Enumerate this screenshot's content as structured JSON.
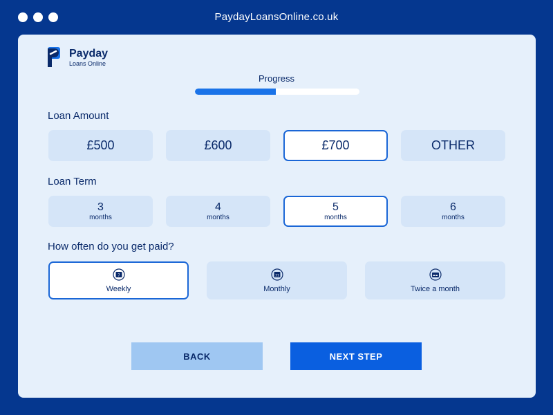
{
  "browser": {
    "url": "PaydayLoansOnline.co.uk"
  },
  "brand": {
    "name": "Payday",
    "tagline": "Loans Online",
    "accent": "#1a73e8"
  },
  "progress": {
    "label": "Progress",
    "fraction": 0.49
  },
  "loan_amount": {
    "label": "Loan Amount",
    "options": [
      "£500",
      "£600",
      "£700",
      "OTHER"
    ],
    "selected": "£700"
  },
  "loan_term": {
    "label": "Loan Term",
    "options": [
      {
        "value": "3",
        "unit": "months"
      },
      {
        "value": "4",
        "unit": "months"
      },
      {
        "value": "5",
        "unit": "months"
      },
      {
        "value": "6",
        "unit": "months"
      }
    ],
    "selected": "5"
  },
  "pay_frequency": {
    "label": "How often do you get paid?",
    "options": [
      {
        "label": "Weekly",
        "icon": "calendar-week-icon",
        "badge": "7"
      },
      {
        "label": "Monthly",
        "icon": "calendar-month-icon",
        "badge": "31"
      },
      {
        "label": "Twice a month",
        "icon": "card-icon",
        "badge": ""
      }
    ],
    "selected": "Weekly"
  },
  "actions": {
    "back": "BACK",
    "next": "NEXT STEP"
  }
}
